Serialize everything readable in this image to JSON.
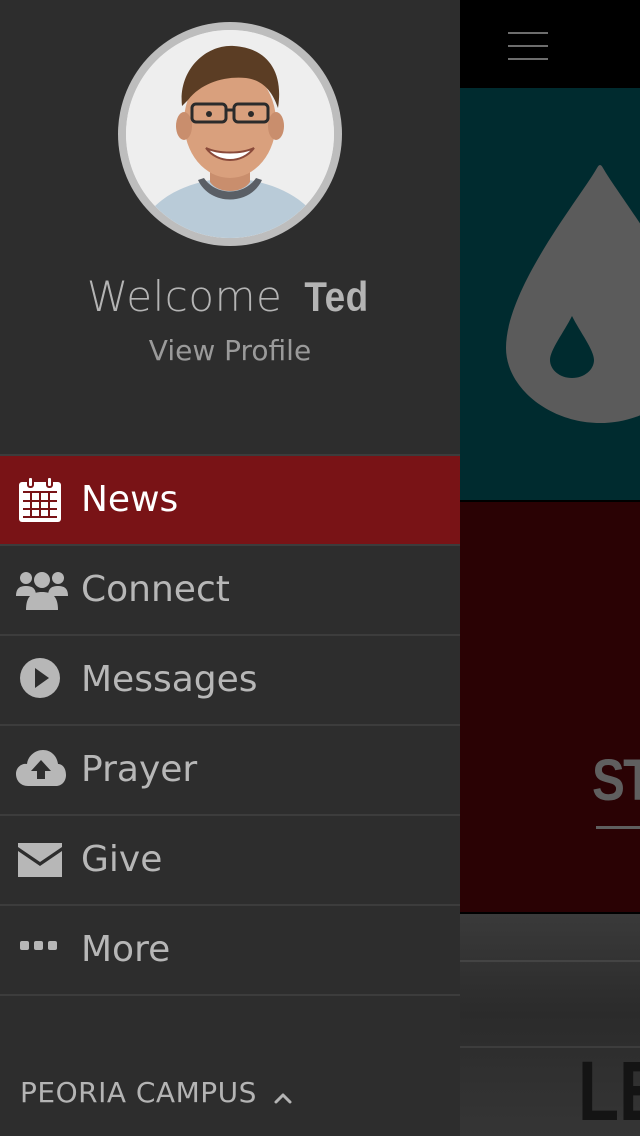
{
  "drawer": {
    "welcome_text": "Welcome",
    "user_name": "Ted",
    "view_profile_label": "View Profile",
    "menu": [
      {
        "label": "News",
        "icon": "calendar-icon",
        "active": true
      },
      {
        "label": "Connect",
        "icon": "users-icon",
        "active": false
      },
      {
        "label": "Messages",
        "icon": "play-circle-icon",
        "active": false
      },
      {
        "label": "Prayer",
        "icon": "cloud-upload-icon",
        "active": false
      },
      {
        "label": "Give",
        "icon": "envelope-icon",
        "active": false
      },
      {
        "label": "More",
        "icon": "ellipsis-icon",
        "active": false
      }
    ],
    "campus_label": "PEORIA CAMPUS",
    "campus_icon": "chevron-up-icon"
  },
  "main": {
    "menu_icon": "hamburger-menu-icon",
    "cards": [
      {
        "icon": "water-drop-icon",
        "color": "#002b2f",
        "title": ""
      },
      {
        "color": "#2a0204",
        "title": "ST"
      },
      {
        "color": "#333333",
        "title": "LE"
      }
    ]
  },
  "colors": {
    "drawer_bg": "#2d2d2d",
    "active_item": "#791316",
    "divider": "#3c3c3c",
    "text": "#b7b7b7"
  }
}
